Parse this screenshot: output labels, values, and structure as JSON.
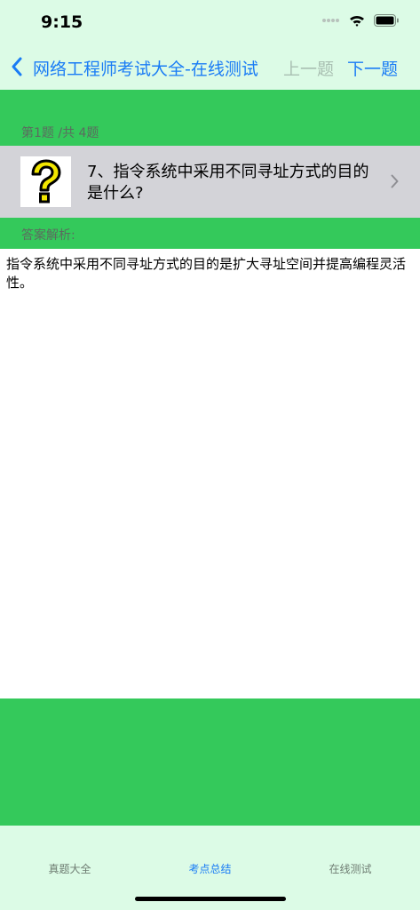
{
  "status_bar": {
    "time": "9:15"
  },
  "nav": {
    "title": "网络工程师考试大全-在线测试",
    "prev_label": "上一题",
    "next_label": "下一题"
  },
  "question": {
    "counter": "第1题 /共 4题",
    "text": "7、指令系统中采用不同寻址方式的目的是什么?",
    "image_icon": "question-mark-icon"
  },
  "answer": {
    "label": "答案解析:",
    "text": "指令系统中采用不同寻址方式的目的是扩大寻址空间并提高编程灵活性。"
  },
  "tabs": [
    {
      "label": "真题大全",
      "selected": false
    },
    {
      "label": "考点总结",
      "selected": true
    },
    {
      "label": "在线测试",
      "selected": false
    }
  ],
  "colors": {
    "accent": "#1a7cf5",
    "header_bg": "#dcfbe6",
    "section_green": "#34c95b",
    "question_row_bg": "#d3d3d8"
  }
}
